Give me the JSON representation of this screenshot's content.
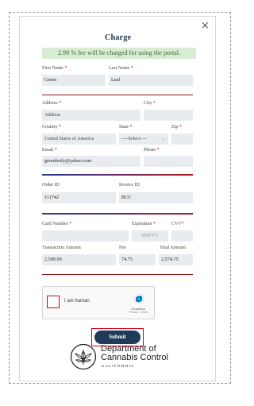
{
  "dialog": {
    "close": "×",
    "title": "Charge",
    "fee_notice": "2.99 % fee will be charged for using the portal."
  },
  "name": {
    "first_label": "First Name",
    "first_value": "Green",
    "last_label": "Last Name",
    "last_value": "Leaf"
  },
  "address": {
    "address_label": "Address",
    "address_placeholder": "Address",
    "city_label": "City",
    "city_value": "",
    "country_label": "Country",
    "country_value": "United States of America",
    "state_label": "State",
    "state_value": "----Select----",
    "zip_label": "Zip",
    "zip_value": "",
    "email_label": "Email",
    "email_value": "greenleafy@yahoo.com",
    "phone_label": "Phone",
    "phone_value": ""
  },
  "order": {
    "order_label": "Order ID",
    "order_value": "111742",
    "invoice_label": "Invoice ID",
    "invoice_value": "BCC"
  },
  "card": {
    "number_label": "Card Number",
    "number_value": "",
    "expiration_label": "Expiration",
    "expiration_placeholder": "MM/YY",
    "cvv_label": "CVV",
    "cvv_value": ""
  },
  "amounts": {
    "transaction_label": "Transaction Amount",
    "transaction_value": "2,500.00",
    "fee_label": "Fee",
    "fee_value": "74.75",
    "total_label": "Total Amount",
    "total_value": "2,574.75"
  },
  "captcha": {
    "label": "I am human",
    "brand": "hCaptcha",
    "links": "Privacy - Terms"
  },
  "submit": "Submit",
  "footer": {
    "org_line1": "Department of",
    "org_line2": "Cannabis Control",
    "org_state": "CALIFORNIA"
  },
  "colors": {
    "accent": "#1f3b57",
    "required": "#d0021b",
    "notice_bg": "#d7ecd2"
  }
}
